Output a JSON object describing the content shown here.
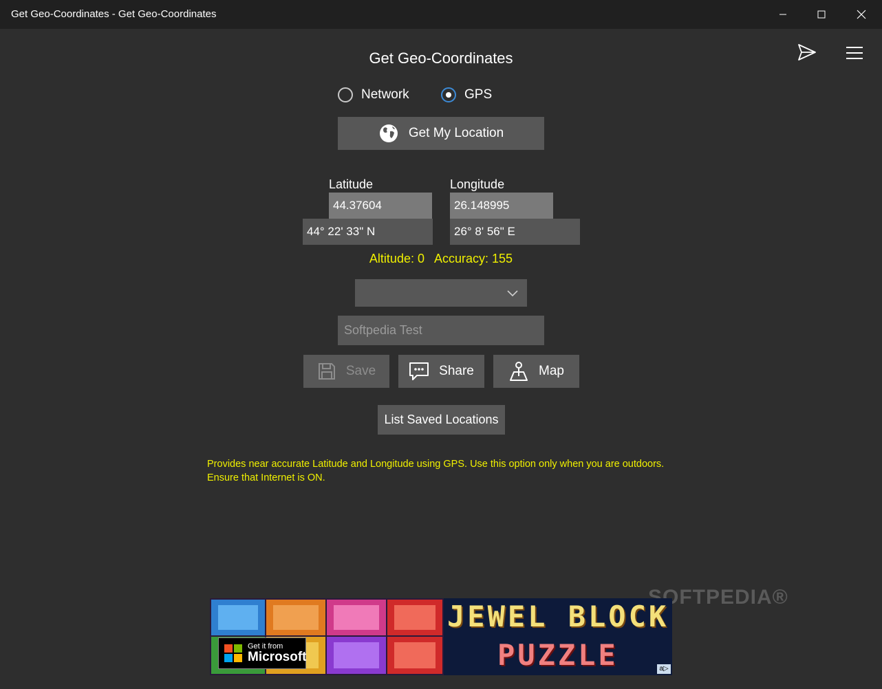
{
  "window": {
    "title": "Get Geo-Coordinates - Get Geo-Coordinates"
  },
  "app": {
    "title": "Get Geo-Coordinates"
  },
  "source": {
    "options": [
      {
        "label": "Network",
        "selected": false
      },
      {
        "label": "GPS",
        "selected": true
      }
    ]
  },
  "buttons": {
    "get_location": "Get My Location",
    "save": "Save",
    "share": "Share",
    "map": "Map",
    "list_saved": "List Saved Locations"
  },
  "coords": {
    "latitude_label": "Latitude",
    "longitude_label": "Longitude",
    "latitude_decimal": "44.37604",
    "longitude_decimal": "26.148995",
    "latitude_dms": "44° 22' 33\" N",
    "longitude_dms": "26° 8' 56\" E"
  },
  "status": {
    "altitude": "Altitude: 0",
    "accuracy": "Accuracy: 155"
  },
  "dropdown": {
    "selected": ""
  },
  "name_input": {
    "placeholder": "Softpedia Test"
  },
  "info_text": "Provides near accurate Latitude and Longitude using GPS. Use this option only when you are outdoors. Ensure that Internet is ON.",
  "ad": {
    "title_line1": "JEWEL BLOCK",
    "title_line2": "PUZZLE",
    "badge_line1": "Get it from",
    "badge_line2": "Microsoft",
    "choice": "a▷"
  },
  "watermark": "SOFTPEDIA®",
  "colors": {
    "accent": "#3c8ad6",
    "status_text": "#f0f000",
    "button_bg": "#575757"
  }
}
